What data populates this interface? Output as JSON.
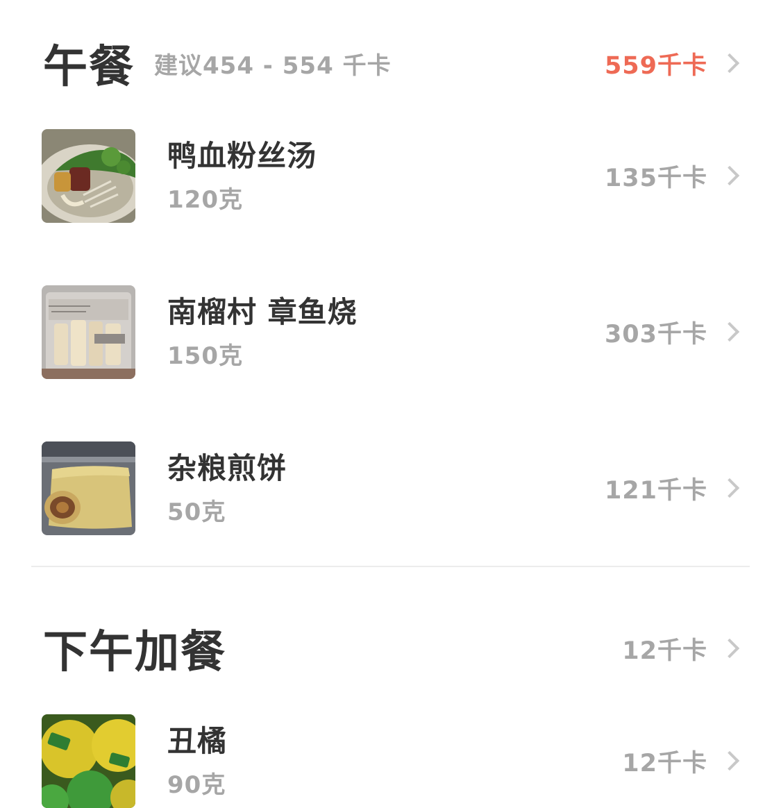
{
  "lunch": {
    "title": "午餐",
    "suggestion": "建议454 - 554 千卡",
    "total": "559千卡",
    "over_color": "#ee6a55",
    "items": [
      {
        "name": "鸭血粉丝汤",
        "amount": "120克",
        "kcal": "135千卡",
        "image": "duck-blood-vermicelli-soup"
      },
      {
        "name": "南榴村 章鱼烧",
        "amount": "150克",
        "kcal": "303千卡",
        "image": "takoyaki-package"
      },
      {
        "name": "杂粮煎饼",
        "amount": "50克",
        "kcal": "121千卡",
        "image": "multigrain-pancake"
      }
    ]
  },
  "snack": {
    "title": "下午加餐",
    "total": "12千卡",
    "items": [
      {
        "name": "丑橘",
        "amount": "90克",
        "kcal": "12千卡",
        "image": "ugli-fruit"
      }
    ]
  }
}
